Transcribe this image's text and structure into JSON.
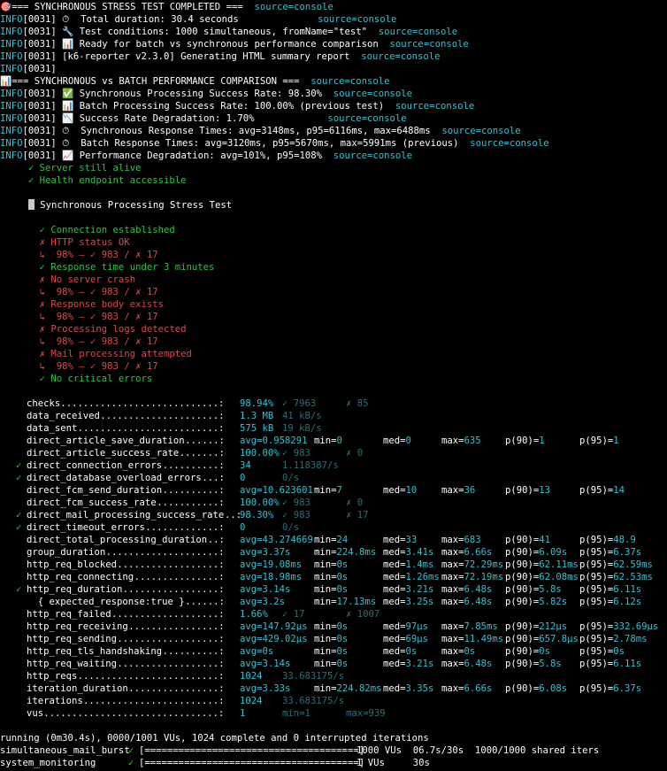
{
  "info_prefix": "INFO[0031]",
  "source_label": "source=console",
  "log_lines": [
    {
      "icon": "🎯",
      "text": "=== SYNCHRONOUS STRESS TEST COMPLETED ===  ",
      "has_info": false,
      "src_gap": ""
    },
    {
      "icon": "",
      "text": " ⏱  Total duration: 30.4 seconds",
      "has_info": true,
      "src_gap": "              "
    },
    {
      "icon": "",
      "text": " 🔧 Test conditions: 1000 simultaneous, fromName=\"test\"  ",
      "has_info": true,
      "src_gap": ""
    },
    {
      "icon": "",
      "text": " 📊 Ready for batch vs synchronous performance comparison  ",
      "has_info": true,
      "src_gap": ""
    },
    {
      "icon": "",
      "text": " [k6-reporter v2.3.0] Generating HTML summary report  ",
      "has_info": true,
      "src_gap": ""
    },
    {
      "icon": "",
      "text": "",
      "has_info": true,
      "src_gap": "",
      "no_source": true
    },
    {
      "icon": "📊",
      "text": "=== SYNCHRONOUS vs BATCH PERFORMANCE COMPARISON ===  ",
      "has_info": false,
      "src_gap": ""
    },
    {
      "icon": "",
      "text": " ✅ Synchronous Processing Success Rate: 98.30%  ",
      "has_info": true,
      "src_gap": ""
    },
    {
      "icon": "",
      "text": " 📊 Batch Processing Success Rate: 100.00% (previous test)  ",
      "has_info": true,
      "src_gap": ""
    },
    {
      "icon": "",
      "text": " 📉 Success Rate Degradation: 1.70%",
      "has_info": true,
      "src_gap": "             "
    },
    {
      "icon": "",
      "text": " ⏱  Synchronous Response Times: avg=3148ms, p95=6116ms, max=6488ms  ",
      "has_info": true,
      "src_gap": ""
    },
    {
      "icon": "",
      "text": " ⏱  Batch Response Times: avg=3120ms, p95=5670ms, max=5991ms (previous)  ",
      "has_info": true,
      "src_gap": ""
    },
    {
      "icon": "",
      "text": " 📈 Performance Degradation: avg=101%, p95=108%  ",
      "has_info": true,
      "src_gap": ""
    }
  ],
  "top_checks": [
    "✓ Server still alive",
    "✓ Health endpoint accessible"
  ],
  "group_title": "Synchronous Processing Stress Test",
  "group_checks": [
    {
      "kind": "pass",
      "text": "✓ Connection established"
    },
    {
      "kind": "fail",
      "text": "✗ HTTP status OK"
    },
    {
      "kind": "sub",
      "text": "↳  98% — ✓ 983 / ✗ 17"
    },
    {
      "kind": "pass",
      "text": "✓ Response time under 3 minutes"
    },
    {
      "kind": "fail",
      "text": "✗ No server crash"
    },
    {
      "kind": "sub",
      "text": "↳  98% — ✓ 983 / ✗ 17"
    },
    {
      "kind": "fail",
      "text": "✗ Response body exists"
    },
    {
      "kind": "sub",
      "text": "↳  98% — ✓ 983 / ✗ 17"
    },
    {
      "kind": "fail",
      "text": "✗ Processing logs detected"
    },
    {
      "kind": "sub",
      "text": "↳  98% — ✓ 983 / ✗ 17"
    },
    {
      "kind": "fail",
      "text": "✗ Mail processing attempted"
    },
    {
      "kind": "sub",
      "text": "↳  98% — ✓ 983 / ✗ 17"
    },
    {
      "kind": "pass",
      "text": "✓ No critical errors"
    }
  ],
  "metrics": [
    {
      "mark": "",
      "name": "checks",
      "v1": "98.94%",
      "v2": "✓ 7963",
      "v3": "✗ 85",
      "mode": "rate"
    },
    {
      "mark": "",
      "name": "data_received",
      "v1": "1.3 MB",
      "v2": "41 kB/s",
      "mode": "counter"
    },
    {
      "mark": "",
      "name": "data_sent",
      "v1": "575 kB",
      "v2": "19 kB/s",
      "mode": "counter"
    },
    {
      "mark": "",
      "name": "direct_article_save_duration",
      "v1": "avg=0.958291",
      "c2": "min=0",
      "c3": "med=0",
      "c4": "max=635",
      "c5": "p(90)=1",
      "c6": "p(95)=1",
      "mode": "trend"
    },
    {
      "mark": "",
      "name": "direct_article_success_rate",
      "v1": "100.00%",
      "v2": "✓ 983",
      "v3": "✗ 0",
      "mode": "rate"
    },
    {
      "mark": "✓",
      "name": "direct_connection_errors",
      "v1": "34",
      "v2": "1.118387/s",
      "mode": "counter"
    },
    {
      "mark": "✓",
      "name": "direct_database_overload_errors",
      "v1": "0",
      "v2": "0/s",
      "mode": "counter"
    },
    {
      "mark": "",
      "name": "direct_fcm_send_duration",
      "v1": "avg=10.623601",
      "c2": "min=7",
      "c3": "med=10",
      "c4": "max=36",
      "c5": "p(90)=13",
      "c6": "p(95)=14",
      "mode": "trend"
    },
    {
      "mark": "",
      "name": "direct_fcm_success_rate",
      "v1": "100.00%",
      "v2": "✓ 983",
      "v3": "✗ 0",
      "mode": "rate"
    },
    {
      "mark": "✓",
      "name": "direct_mail_processing_success_rate",
      "v1": "98.30%",
      "v2": "✓ 983",
      "v3": "✗ 17",
      "mode": "rate"
    },
    {
      "mark": "✓",
      "name": "direct_timeout_errors",
      "v1": "0",
      "v2": "0/s",
      "mode": "counter"
    },
    {
      "mark": "",
      "name": "direct_total_processing_duration",
      "v1": "avg=43.274669",
      "c2": "min=24",
      "c3": "med=33",
      "c4": "max=683",
      "c5": "p(90)=41",
      "c6": "p(95)=48.9",
      "mode": "trend"
    },
    {
      "mark": "",
      "name": "group_duration",
      "v1": "avg=3.37s",
      "c2": "min=224.8ms",
      "c3": "med=3.41s",
      "c4": "max=6.66s",
      "c5": "p(90)=6.09s",
      "c6": "p(95)=6.37s",
      "mode": "trend"
    },
    {
      "mark": "",
      "name": "http_req_blocked",
      "v1": "avg=19.08ms",
      "c2": "min=0s",
      "c3": "med=1.4ms",
      "c4": "max=72.29ms",
      "c5": "p(90)=62.11ms",
      "c6": "p(95)=62.59ms",
      "mode": "trend"
    },
    {
      "mark": "",
      "name": "http_req_connecting",
      "v1": "avg=18.98ms",
      "c2": "min=0s",
      "c3": "med=1.26ms",
      "c4": "max=72.19ms",
      "c5": "p(90)=62.08ms",
      "c6": "p(95)=62.53ms",
      "mode": "trend"
    },
    {
      "mark": "✓",
      "name": "http_req_duration",
      "v1": "avg=3.14s",
      "c2": "min=0s",
      "c3": "med=3.21s",
      "c4": "max=6.48s",
      "c5": "p(90)=5.8s",
      "c6": "p(95)=6.11s",
      "mode": "trend"
    },
    {
      "mark": "",
      "name": "  { expected_response:true }",
      "v1": "avg=3.2s",
      "c2": "min=17.13ms",
      "c3": "med=3.25s",
      "c4": "max=6.48s",
      "c5": "p(90)=5.82s",
      "c6": "p(95)=6.12s",
      "mode": "trend"
    },
    {
      "mark": "",
      "name": "http_req_failed",
      "v1": "1.66%",
      "v2": "✓ 17",
      "v3": "✗ 1007",
      "mode": "rate"
    },
    {
      "mark": "",
      "name": "http_req_receiving",
      "v1": "avg=147.92µs",
      "c2": "min=0s",
      "c3": "med=97µs",
      "c4": "max=7.85ms",
      "c5": "p(90)=212µs",
      "c6": "p(95)=332.69µs",
      "mode": "trend"
    },
    {
      "mark": "",
      "name": "http_req_sending",
      "v1": "avg=429.02µs",
      "c2": "min=0s",
      "c3": "med=69µs",
      "c4": "max=11.49ms",
      "c5": "p(90)=657.8µs",
      "c6": "p(95)=2.78ms",
      "mode": "trend"
    },
    {
      "mark": "",
      "name": "http_req_tls_handshaking",
      "v1": "avg=0s",
      "c2": "min=0s",
      "c3": "med=0s",
      "c4": "max=0s",
      "c5": "p(90)=0s",
      "c6": "p(95)=0s",
      "mode": "trend"
    },
    {
      "mark": "",
      "name": "http_req_waiting",
      "v1": "avg=3.14s",
      "c2": "min=0s",
      "c3": "med=3.21s",
      "c4": "max=6.48s",
      "c5": "p(90)=5.8s",
      "c6": "p(95)=6.11s",
      "mode": "trend"
    },
    {
      "mark": "",
      "name": "http_reqs",
      "v1": "1024",
      "v2": "33.683175/s",
      "mode": "counter"
    },
    {
      "mark": "",
      "name": "iteration_duration",
      "v1": "avg=3.33s",
      "c2": "min=224.82ms",
      "c3": "med=3.35s",
      "c4": "max=6.66s",
      "c5": "p(90)=6.08s",
      "c6": "p(95)=6.37s",
      "mode": "trend"
    },
    {
      "mark": "",
      "name": "iterations",
      "v1": "1024",
      "v2": "33.683175/s",
      "mode": "counter"
    },
    {
      "mark": "",
      "name": "vus",
      "v1": "1",
      "v2": "min=1",
      "v3": "max=939",
      "mode": "gauge"
    }
  ],
  "footer": {
    "running": "running (0m30.4s), 0000/1001 VUs, 1024 complete and 0 interrupted iterations",
    "scenarios": [
      {
        "name": "simultaneous_mail_burst",
        "bar": "[======================================]",
        "status": "1000 VUs  06.7s/30s  1000/1000 shared iters"
      },
      {
        "name": "system_monitoring",
        "bar": "[======================================]",
        "status": "1 VUs     30s"
      }
    ]
  }
}
